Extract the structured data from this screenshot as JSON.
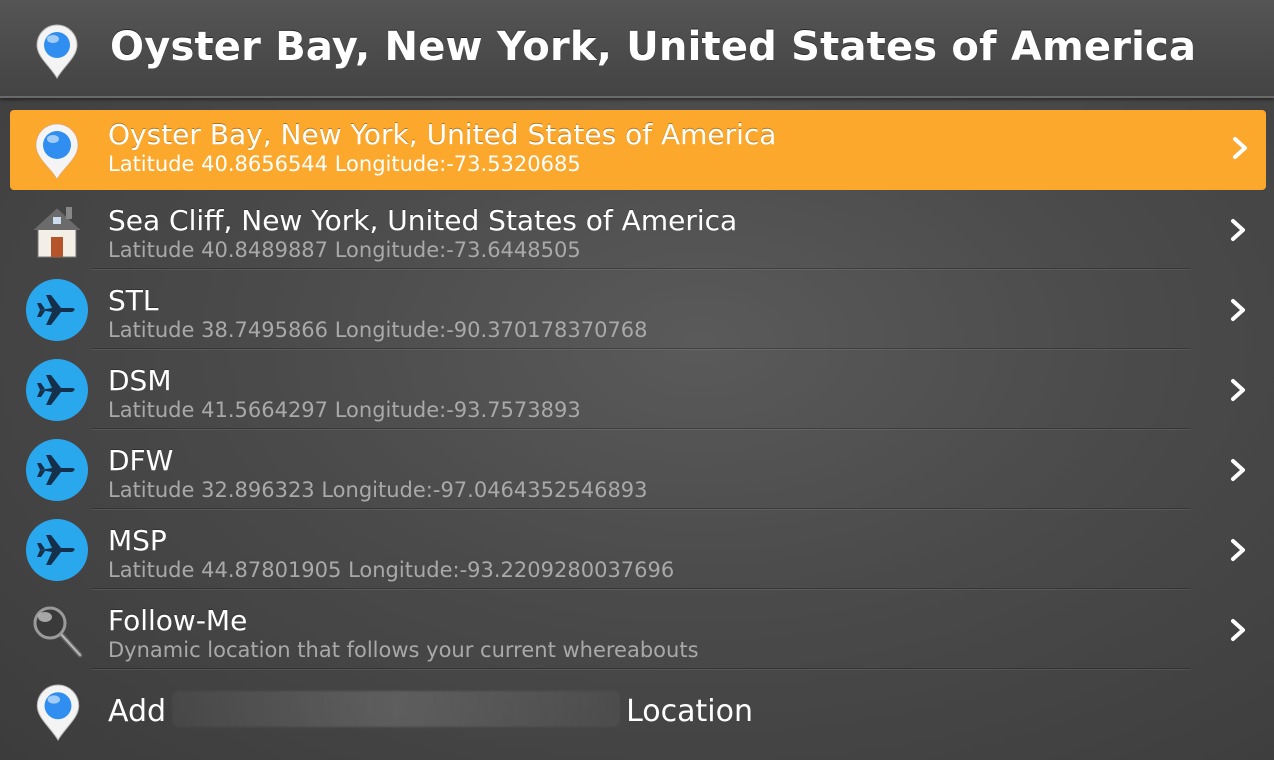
{
  "header": {
    "title": "Oyster Bay, New York, United States of America",
    "icon": "map-pin-icon"
  },
  "locations": [
    {
      "name": "Oyster Bay, New York, United States of America",
      "sub": "Latitude 40.8656544 Longitude:-73.5320685",
      "icon": "map-pin-icon",
      "selected": true
    },
    {
      "name": "Sea Cliff, New York, United States of America",
      "sub": "Latitude 40.8489887 Longitude:-73.6448505",
      "icon": "house-icon"
    },
    {
      "name": "STL",
      "sub": "Latitude 38.7495866 Longitude:-90.370178370768",
      "icon": "airplane-icon"
    },
    {
      "name": "DSM",
      "sub": "Latitude 41.5664297 Longitude:-93.7573893",
      "icon": "airplane-icon"
    },
    {
      "name": "DFW",
      "sub": "Latitude 32.896323 Longitude:-97.0464352546893",
      "icon": "airplane-icon"
    },
    {
      "name": "MSP",
      "sub": "Latitude 44.87801905 Longitude:-93.2209280037696",
      "icon": "airplane-icon"
    },
    {
      "name": "Follow-Me",
      "sub": "Dynamic location that follows your current whereabouts",
      "icon": "magnifier-icon"
    }
  ],
  "add_location": {
    "prefix": "Add",
    "suffix": "Location",
    "icon": "map-pin-icon"
  },
  "colors": {
    "selected": "#fca82c",
    "pin": "#2f8ef0",
    "airplane_circle": "#2aa8ee"
  }
}
